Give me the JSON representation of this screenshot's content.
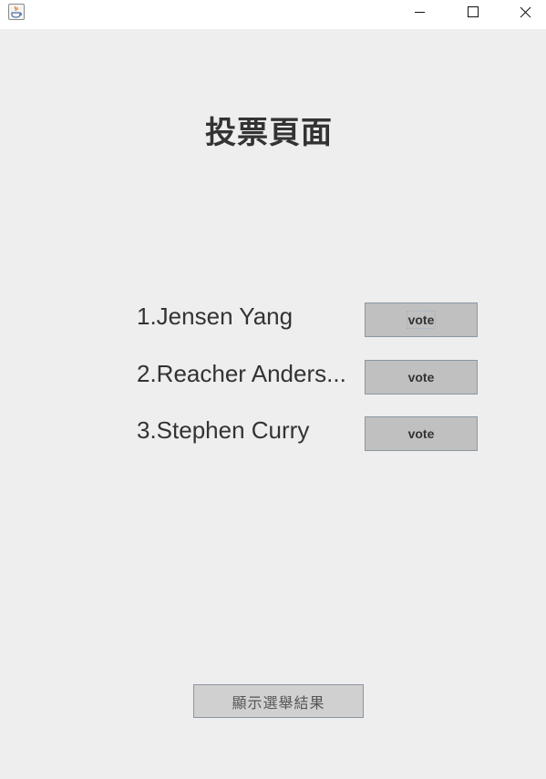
{
  "window": {
    "icon": "java-icon",
    "controls": [
      "minimize-icon",
      "maximize-icon",
      "close-icon"
    ]
  },
  "page": {
    "title": "投票頁面"
  },
  "candidates": [
    {
      "name": "1.Jensen Yang",
      "vote_label": "vote"
    },
    {
      "name": "2.Reacher Anders...",
      "vote_label": "vote"
    },
    {
      "name": "3.Stephen Curry",
      "vote_label": "vote"
    }
  ],
  "results_button": {
    "label": "顯示選舉結果"
  }
}
